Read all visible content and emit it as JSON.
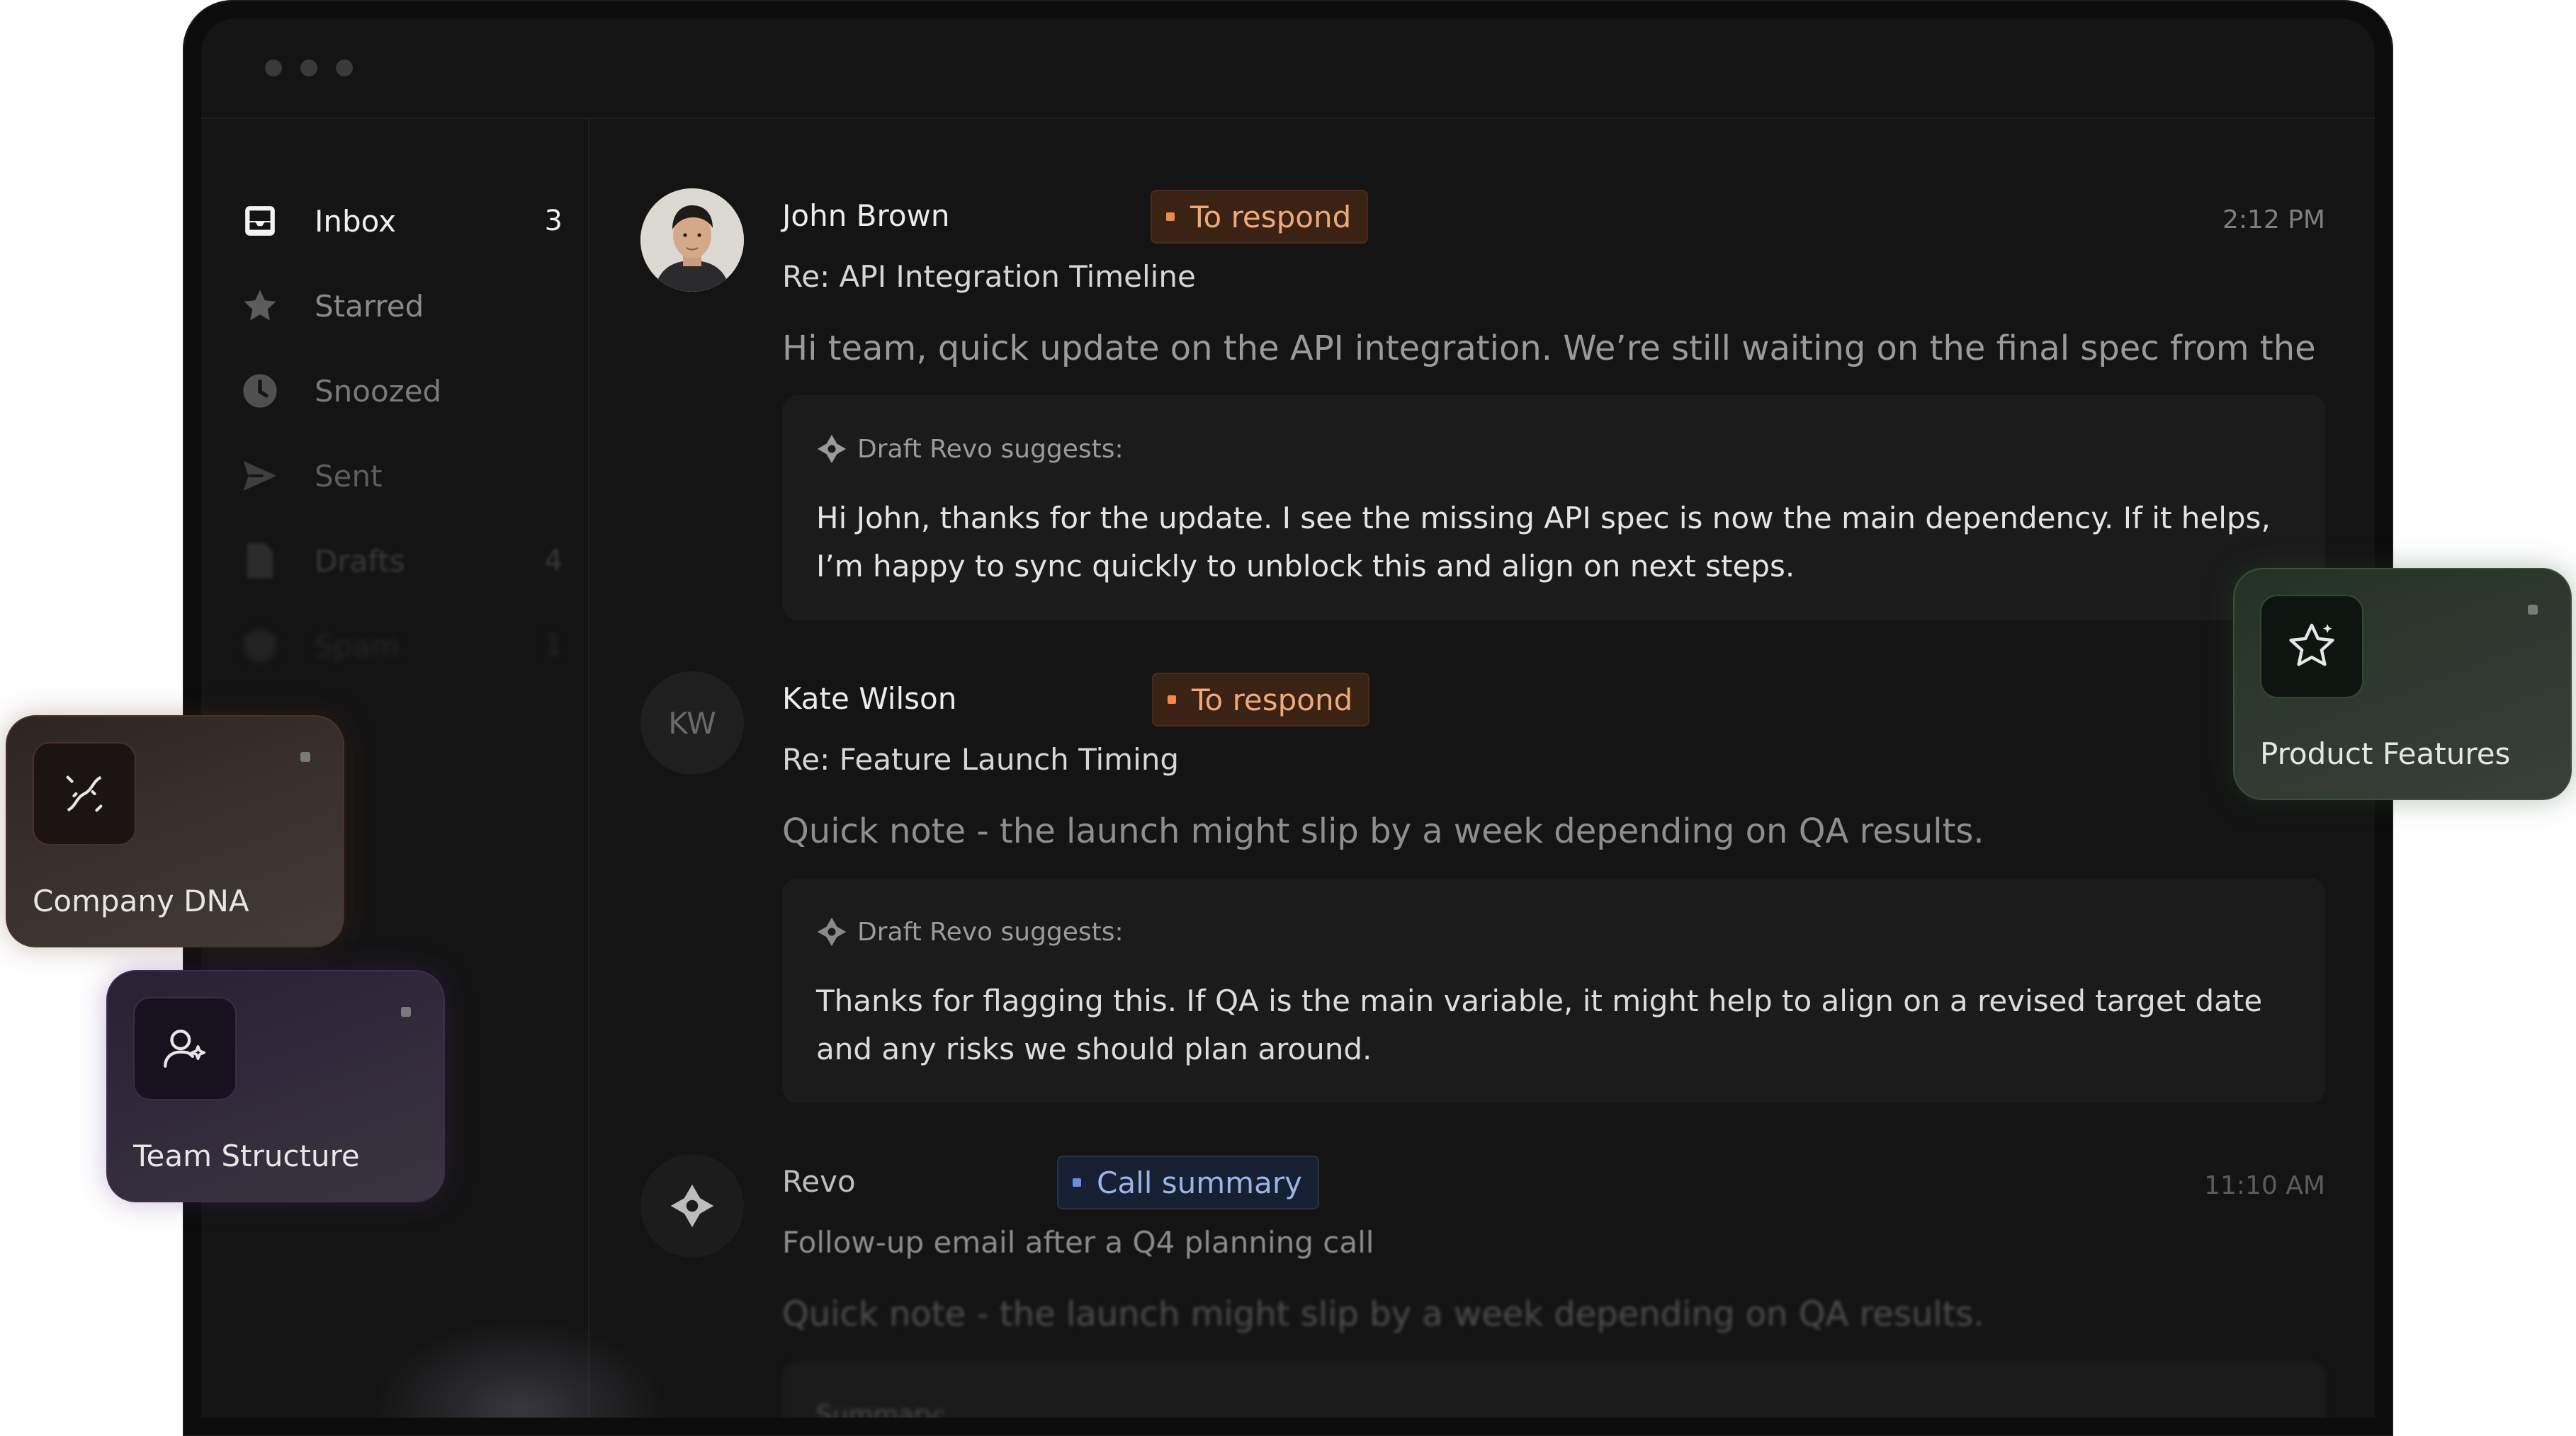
{
  "sidebar": {
    "items": [
      {
        "label": "Inbox",
        "count": "3",
        "icon": "inbox-icon"
      },
      {
        "label": "Starred",
        "count": "",
        "icon": "star-icon"
      },
      {
        "label": "Snoozed",
        "count": "",
        "icon": "clock-icon"
      },
      {
        "label": "Sent",
        "count": "",
        "icon": "send-icon"
      },
      {
        "label": "Drafts",
        "count": "4",
        "icon": "document-icon"
      },
      {
        "label": "Spam",
        "count": "1",
        "icon": "warning-icon"
      }
    ]
  },
  "emails": [
    {
      "sender": "John Brown",
      "tag": "To respond",
      "time": "2:12 PM",
      "subject": "Re: API Integration Timeline",
      "preview": "Hi team, quick update on the API integration. We’re still waiting on the final spec from the partner...",
      "draft_heading": "Draft Revo suggests:",
      "draft_text": "Hi John, thanks for the update. I see the missing API spec is now the main dependency. If it helps, I’m happy to sync quickly to unblock this and align on next steps."
    },
    {
      "sender": "Kate Wilson",
      "initials": "KW",
      "tag": "To respond",
      "subject": "Re: Feature Launch Timing",
      "preview": "Quick note - the launch might slip by a week depending on QA results.",
      "draft_heading": "Draft Revo suggests:",
      "draft_text": "Thanks for flagging this. If QA is the main variable, it might help to align on a revised target date and any risks we should plan around."
    },
    {
      "sender": "Revo",
      "tag": "Call summary",
      "time": "11:10 AM",
      "subject": "Follow-up email after a Q4 planning call",
      "preview": "Quick note - the launch might slip by a week depending on QA results.",
      "summary_heading": "Summary:"
    }
  ],
  "cards": {
    "product_features": "Product Features",
    "company_dna": "Company DNA",
    "team_structure": "Team Structure"
  },
  "colors": {
    "respond_tag": "#f0a878",
    "call_tag": "#9ab4e4",
    "background": "#141414"
  }
}
